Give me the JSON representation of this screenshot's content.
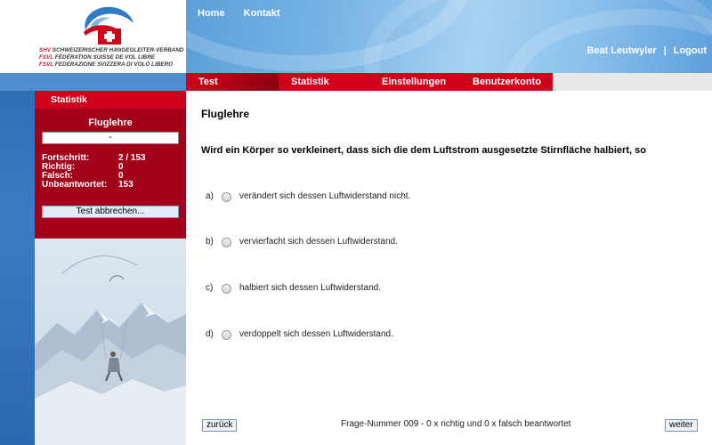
{
  "logo": {
    "lines": [
      {
        "prefix": "SHV",
        "text": " SCHWEIZERISCHER HANGEGLEITER-VERBAND"
      },
      {
        "prefix": "FSVL",
        "text": " FÉDÉRATION SUISSE DE VOL LIBRE"
      },
      {
        "prefix": "FSVL",
        "text": " FEDERAZIONE SVIZZERA DI VOLO LIBERO"
      }
    ]
  },
  "top_nav": {
    "home": "Home",
    "contact": "Kontakt"
  },
  "user_nav": {
    "user": "Beat Leutwyler",
    "separator": "|",
    "logout": "Logout"
  },
  "tabs": [
    {
      "label": "Test"
    },
    {
      "label": "Statistik"
    },
    {
      "label": "Einstellungen"
    },
    {
      "label": "Benutzerkonto"
    }
  ],
  "sidebar": {
    "heading": "Statistik",
    "box_title": "Fluglehre",
    "progress_value": "-",
    "stats": [
      {
        "label": "Fortschritt:",
        "value": "2 / 153"
      },
      {
        "label": "Richtig:",
        "value": "0"
      },
      {
        "label": "Falsch:",
        "value": "0"
      },
      {
        "label": "Unbeantwortet:",
        "value": "153"
      }
    ],
    "abort_label": "Test abbrechen..."
  },
  "main": {
    "title": "Fluglehre",
    "question": "Wird ein Körper so verkleinert, dass sich die dem Luftstrom ausgesetzte Stirnfläche halbiert, so",
    "answers": [
      {
        "letter": "a)",
        "text": "verändert sich dessen Luftwiderstand nicht."
      },
      {
        "letter": "b)",
        "text": "vervierfacht sich dessen Luftwiderstand."
      },
      {
        "letter": "c)",
        "text": "halbiert sich dessen Luftwiderstand."
      },
      {
        "letter": "d)",
        "text": "verdoppelt sich dessen Luftwiderstand."
      }
    ],
    "prev_label": "zurück",
    "next_label": "weiter",
    "footer_info": "Frage-Nummer 009 - 0 x richtig und 0 x falsch beantwortet"
  },
  "colors": {
    "brand_red": "#d0021b",
    "dark_red": "#a3001a",
    "header_blue": "#5b9fd9"
  }
}
